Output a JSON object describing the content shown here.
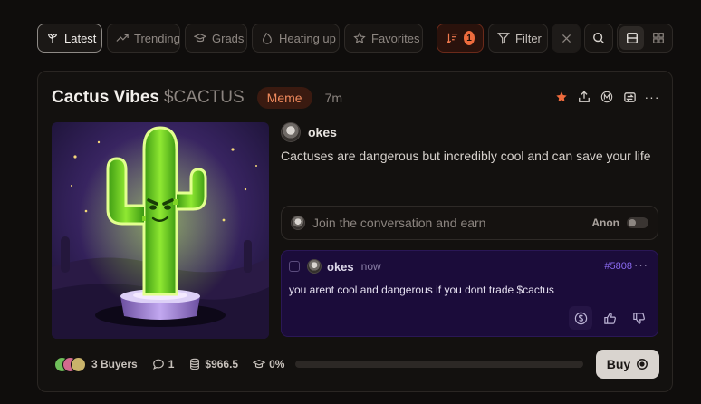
{
  "filters": {
    "latest": "Latest",
    "trending": "Trending",
    "grads": "Grads",
    "heating_up": "Heating up",
    "favorites": "Favorites",
    "sort_badge": "1",
    "filter": "Filter"
  },
  "coin": {
    "name": "Cactus Vibes",
    "ticker": "$CACTUS",
    "tag": "Meme",
    "age": "7m",
    "author": "okes",
    "description": "Cactuses are dangerous but incredibly cool and can save your life",
    "comment_placeholder": "Join the conversation and earn",
    "anon_label": "Anon"
  },
  "reply": {
    "author": "okes",
    "time": "now",
    "id": "#5808",
    "more": "···",
    "text": "you arent cool and dangerous if you dont trade $cactus"
  },
  "stats": {
    "buyers": "3 Buyers",
    "comments": "1",
    "market_cap": "$966.5",
    "progress_label": "0%",
    "progress_value": 0
  },
  "buy_label": "Buy",
  "colors": {
    "accent": "#ee6b3d",
    "reply_bg": "#1b0c3a",
    "reply_id": "#8a6af0"
  }
}
